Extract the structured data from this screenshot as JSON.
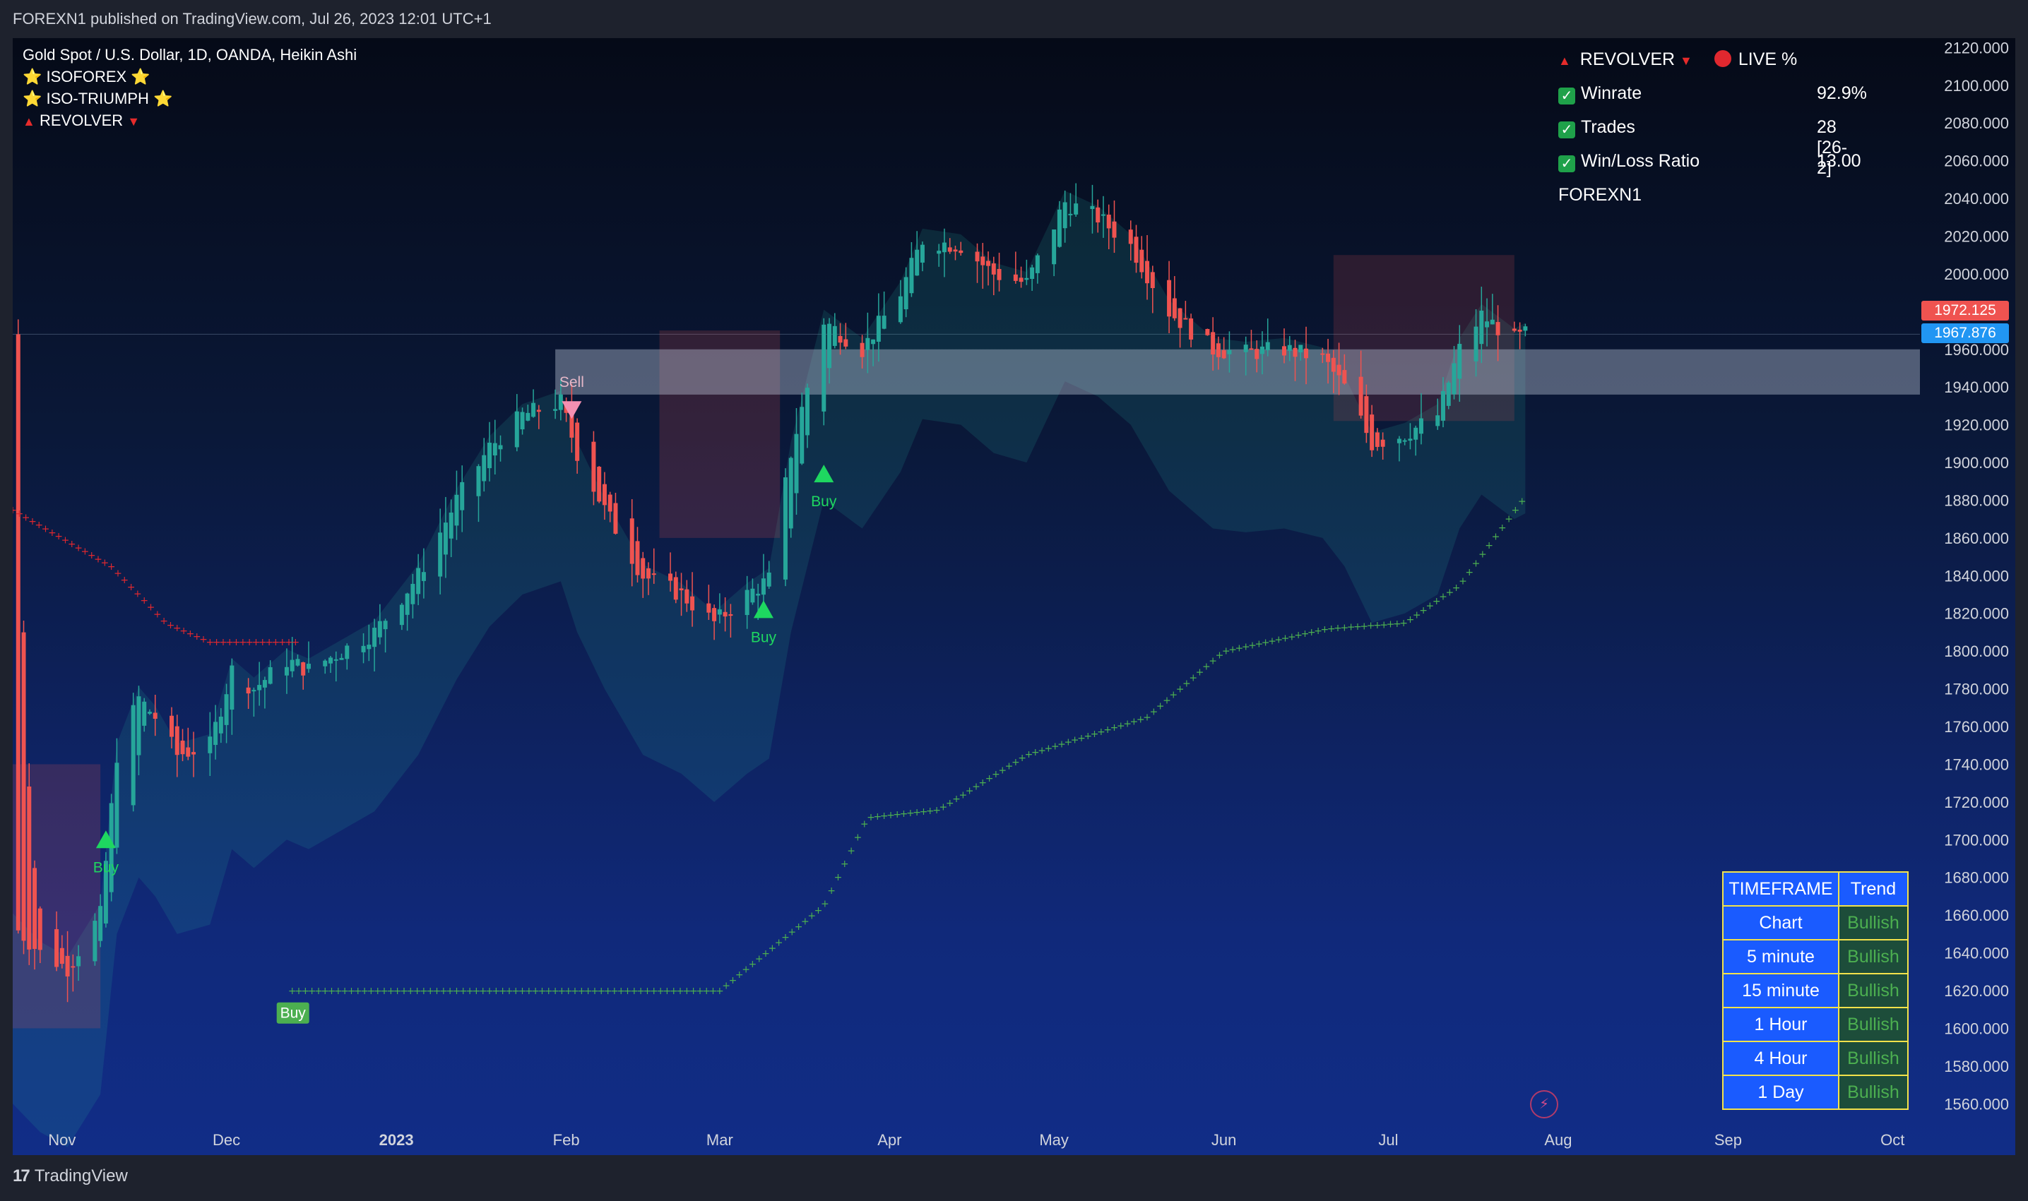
{
  "header": {
    "publish_text": "FOREXN1 published on TradingView.com, Jul 26, 2023 12:01 UTC+1"
  },
  "footer": {
    "brand": "TradingView",
    "logo_mark": "17"
  },
  "legend": {
    "symbol": "Gold Spot / U.S. Dollar, 1D, OANDA, Heikin Ashi",
    "indicators": [
      "⭐ ISOFOREX ⭐",
      "⭐ ISO-TRIUMPH ⭐",
      "REVOLVER"
    ]
  },
  "stats": {
    "title_left": "REVOLVER",
    "title_right": "LIVE %",
    "rows": [
      {
        "label": "Winrate",
        "value": "92.9%"
      },
      {
        "label": "Trades",
        "value": "28 [26-2]"
      },
      {
        "label": "Win/Loss Ratio",
        "value": "13.00"
      }
    ],
    "author": "FOREXN1"
  },
  "timeframe_table": {
    "header": [
      "TIMEFRAME",
      "Trend"
    ],
    "rows": [
      {
        "tf": "Chart",
        "trend": "Bullish"
      },
      {
        "tf": "5 minute",
        "trend": "Bullish"
      },
      {
        "tf": "15 minute",
        "trend": "Bullish"
      },
      {
        "tf": "1 Hour",
        "trend": "Bullish"
      },
      {
        "tf": "4 Hour",
        "trend": "Bullish"
      },
      {
        "tf": "1 Day",
        "trend": "Bullish"
      }
    ]
  },
  "price_tags": {
    "upper": "1972.125",
    "lower": "1967.876"
  },
  "colors": {
    "bull": "#26a69a",
    "bear": "#ef5350",
    "signal_buy": "#1ed760",
    "signal_sell": "#f48fb1",
    "buy_label_bg": "#4caf50"
  },
  "chart_data": {
    "type": "candlestick",
    "ylim": [
      1550,
      2125
    ],
    "y_ticks": [
      2120,
      2100,
      2080,
      2060,
      2040,
      2020,
      2000,
      1980,
      1960,
      1940,
      1920,
      1900,
      1880,
      1860,
      1840,
      1820,
      1800,
      1780,
      1760,
      1740,
      1720,
      1700,
      1680,
      1660,
      1640,
      1620,
      1600,
      1580,
      1560
    ],
    "x_ticks": [
      {
        "label": "Nov",
        "date": "2022-11-01",
        "bold": false
      },
      {
        "label": "Dec",
        "date": "2022-12-01",
        "bold": false
      },
      {
        "label": "2023",
        "date": "2023-01-01",
        "bold": true
      },
      {
        "label": "Feb",
        "date": "2023-02-01",
        "bold": false
      },
      {
        "label": "Mar",
        "date": "2023-03-01",
        "bold": false
      },
      {
        "label": "Apr",
        "date": "2023-04-01",
        "bold": false
      },
      {
        "label": "May",
        "date": "2023-05-01",
        "bold": false
      },
      {
        "label": "Jun",
        "date": "2023-06-01",
        "bold": false
      },
      {
        "label": "Jul",
        "date": "2023-07-01",
        "bold": false
      },
      {
        "label": "Aug",
        "date": "2023-08-01",
        "bold": false
      },
      {
        "label": "Sep",
        "date": "2023-09-01",
        "bold": false
      },
      {
        "label": "Oct",
        "date": "2023-10-01",
        "bold": false
      }
    ],
    "xlim": [
      "2022-10-23",
      "2023-10-06"
    ],
    "close_path": [
      [
        "2022-10-23",
        1655
      ],
      [
        "2022-10-28",
        1640
      ],
      [
        "2022-11-02",
        1632
      ],
      [
        "2022-11-08",
        1660
      ],
      [
        "2022-11-11",
        1745
      ],
      [
        "2022-11-15",
        1775
      ],
      [
        "2022-11-18",
        1765
      ],
      [
        "2022-11-22",
        1745
      ],
      [
        "2022-11-28",
        1750
      ],
      [
        "2022-12-02",
        1790
      ],
      [
        "2022-12-06",
        1780
      ],
      [
        "2022-12-12",
        1795
      ],
      [
        "2022-12-16",
        1790
      ],
      [
        "2022-12-22",
        1800
      ],
      [
        "2022-12-28",
        1810
      ],
      [
        "2023-01-05",
        1840
      ],
      [
        "2023-01-12",
        1880
      ],
      [
        "2023-01-18",
        1908
      ],
      [
        "2023-01-24",
        1925
      ],
      [
        "2023-01-31",
        1932
      ],
      [
        "2023-02-03",
        1905
      ],
      [
        "2023-02-08",
        1875
      ],
      [
        "2023-02-15",
        1840
      ],
      [
        "2023-02-22",
        1830
      ],
      [
        "2023-02-28",
        1815
      ],
      [
        "2023-03-06",
        1830
      ],
      [
        "2023-03-10",
        1838
      ],
      [
        "2023-03-14",
        1905
      ],
      [
        "2023-03-20",
        1975
      ],
      [
        "2023-03-27",
        1960
      ],
      [
        "2023-04-03",
        1990
      ],
      [
        "2023-04-07",
        2018
      ],
      [
        "2023-04-14",
        2015
      ],
      [
        "2023-04-20",
        2000
      ],
      [
        "2023-04-26",
        1995
      ],
      [
        "2023-05-03",
        2038
      ],
      [
        "2023-05-09",
        2030
      ],
      [
        "2023-05-15",
        2015
      ],
      [
        "2023-05-22",
        1980
      ],
      [
        "2023-05-30",
        1960
      ],
      [
        "2023-06-05",
        1958
      ],
      [
        "2023-06-12",
        1960
      ],
      [
        "2023-06-19",
        1955
      ],
      [
        "2023-06-23",
        1940
      ],
      [
        "2023-06-28",
        1910
      ],
      [
        "2023-07-04",
        1915
      ],
      [
        "2023-07-10",
        1925
      ],
      [
        "2023-07-14",
        1960
      ],
      [
        "2023-07-18",
        1978
      ],
      [
        "2023-07-24",
        1965
      ],
      [
        "2023-07-26",
        1968
      ]
    ],
    "revolver_stop": [
      [
        "2022-10-23",
        1875
      ],
      [
        "2022-11-10",
        1845
      ],
      [
        "2022-11-20",
        1815
      ],
      [
        "2022-11-28",
        1805
      ],
      [
        "2022-12-14",
        1805
      ]
    ],
    "isoforex_trail": [
      [
        "2022-12-13",
        1620
      ],
      [
        "2023-03-01",
        1620
      ],
      [
        "2023-03-20",
        1665
      ],
      [
        "2023-03-28",
        1712
      ],
      [
        "2023-04-10",
        1716
      ],
      [
        "2023-04-26",
        1745
      ],
      [
        "2023-05-18",
        1765
      ],
      [
        "2023-06-01",
        1800
      ],
      [
        "2023-06-20",
        1812
      ],
      [
        "2023-07-04",
        1815
      ],
      [
        "2023-07-14",
        1835
      ],
      [
        "2023-07-26",
        1882
      ]
    ],
    "zones": [
      {
        "date_start": "2023-01-30",
        "date_end": "2023-10-06",
        "y_high": 1960,
        "y_low": 1936
      }
    ],
    "signals": [
      {
        "type": "Buy",
        "date": "2022-11-09",
        "price": 1700
      },
      {
        "type": "Sell",
        "date": "2023-02-02",
        "price": 1928
      },
      {
        "type": "Buy",
        "date": "2023-03-09",
        "price": 1822
      },
      {
        "type": "Buy",
        "date": "2023-03-20",
        "price": 1894
      },
      {
        "type": "Buy",
        "date": "2022-12-13",
        "price": 1610,
        "boxed": true
      }
    ]
  }
}
